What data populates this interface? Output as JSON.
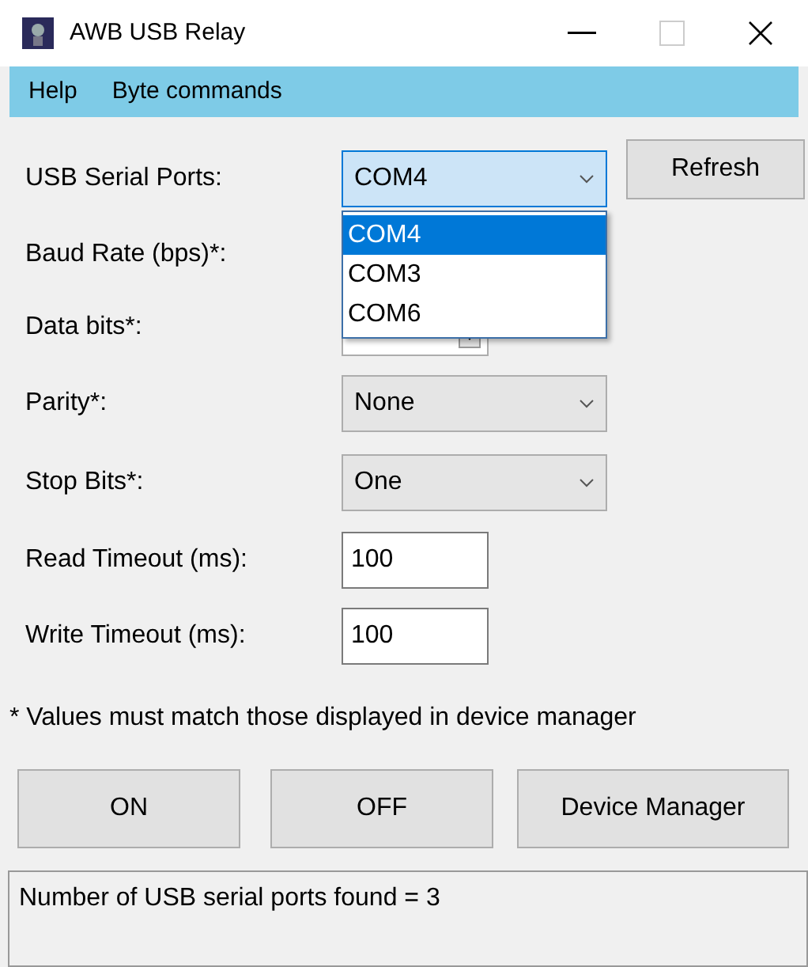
{
  "window": {
    "title": "AWB USB Relay"
  },
  "menu": [
    {
      "label": "Help"
    },
    {
      "label": "Byte commands"
    }
  ],
  "fields": [
    {
      "kind": "combo",
      "label": "USB Serial Ports:",
      "value": "COM4",
      "open": true,
      "button": "Refresh",
      "options": [
        {
          "label": "COM4",
          "selected": true
        },
        {
          "label": "COM3",
          "selected": false
        },
        {
          "label": "COM6",
          "selected": false
        }
      ]
    },
    {
      "kind": "label",
      "label": "Baud Rate (bps)*:"
    },
    {
      "kind": "legacy-combo",
      "label": "Data bits*:"
    },
    {
      "kind": "combo",
      "label": "Parity*:",
      "value": "None",
      "open": false
    },
    {
      "kind": "combo",
      "label": "Stop Bits*:",
      "value": "One",
      "open": false
    },
    {
      "kind": "text",
      "label": "Read Timeout (ms):",
      "value": "100"
    },
    {
      "kind": "text",
      "label": "Write Timeout (ms):",
      "value": "100"
    }
  ],
  "note": "* Values must match those displayed in device manager",
  "buttons": [
    {
      "label": "ON"
    },
    {
      "label": "OFF"
    },
    {
      "label": "Device Manager"
    }
  ],
  "status_bar": "Number of USB serial ports found = 3"
}
